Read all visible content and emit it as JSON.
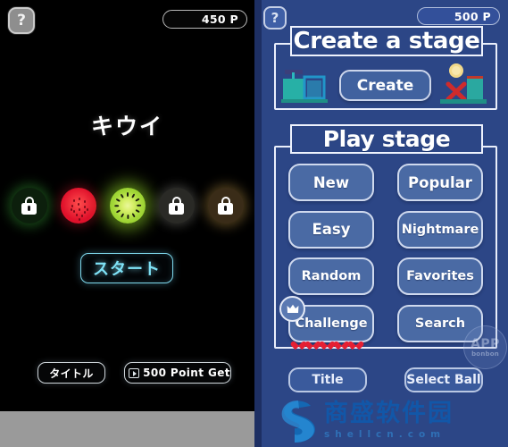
{
  "left_panel": {
    "help_button": "?",
    "points_badge": "450 P",
    "fruit_name": "キウイ",
    "fruit_slots": [
      {
        "name": "locked-green",
        "locked": true
      },
      {
        "name": "watermelon",
        "locked": false
      },
      {
        "name": "kiwi",
        "locked": false
      },
      {
        "name": "locked-grey",
        "locked": true
      },
      {
        "name": "locked-brown",
        "locked": true
      }
    ],
    "start_button": "スタート",
    "title_button": "タイトル",
    "point_get_button": "500 Point Get",
    "ad_icon": "video-ad-icon"
  },
  "right_panel": {
    "help_button": "?",
    "points_badge": "500 P",
    "create_section": {
      "header": "Create a stage",
      "create_button": "Create",
      "left_art": "stage-blocks-icon",
      "right_art": "target-and-ball-icon"
    },
    "play_section": {
      "header": "Play stage",
      "buttons": [
        [
          "New",
          "Popular"
        ],
        [
          "Easy",
          "Nightmare"
        ],
        [
          "Random",
          "Favorites"
        ],
        [
          "Challenge",
          "Search"
        ]
      ],
      "challenge_badge": "crown-icon",
      "hearts": 5
    },
    "bottom_buttons": [
      "Title",
      "Select Ball"
    ],
    "app_badge": {
      "line1": "APP",
      "line2": "bonbon"
    }
  },
  "watermark": {
    "cn": "商盛软件园",
    "en": "shellcn.com",
    "logo": "s-swirl-logo"
  },
  "colors": {
    "right_bg": "#2c4686",
    "button_fill": "#4a6aa4",
    "border": "#cfd9ee",
    "neon_cyan": "#7fe3f7",
    "heart_red": "#e51f33",
    "watermark_blue": "#1257a8"
  }
}
